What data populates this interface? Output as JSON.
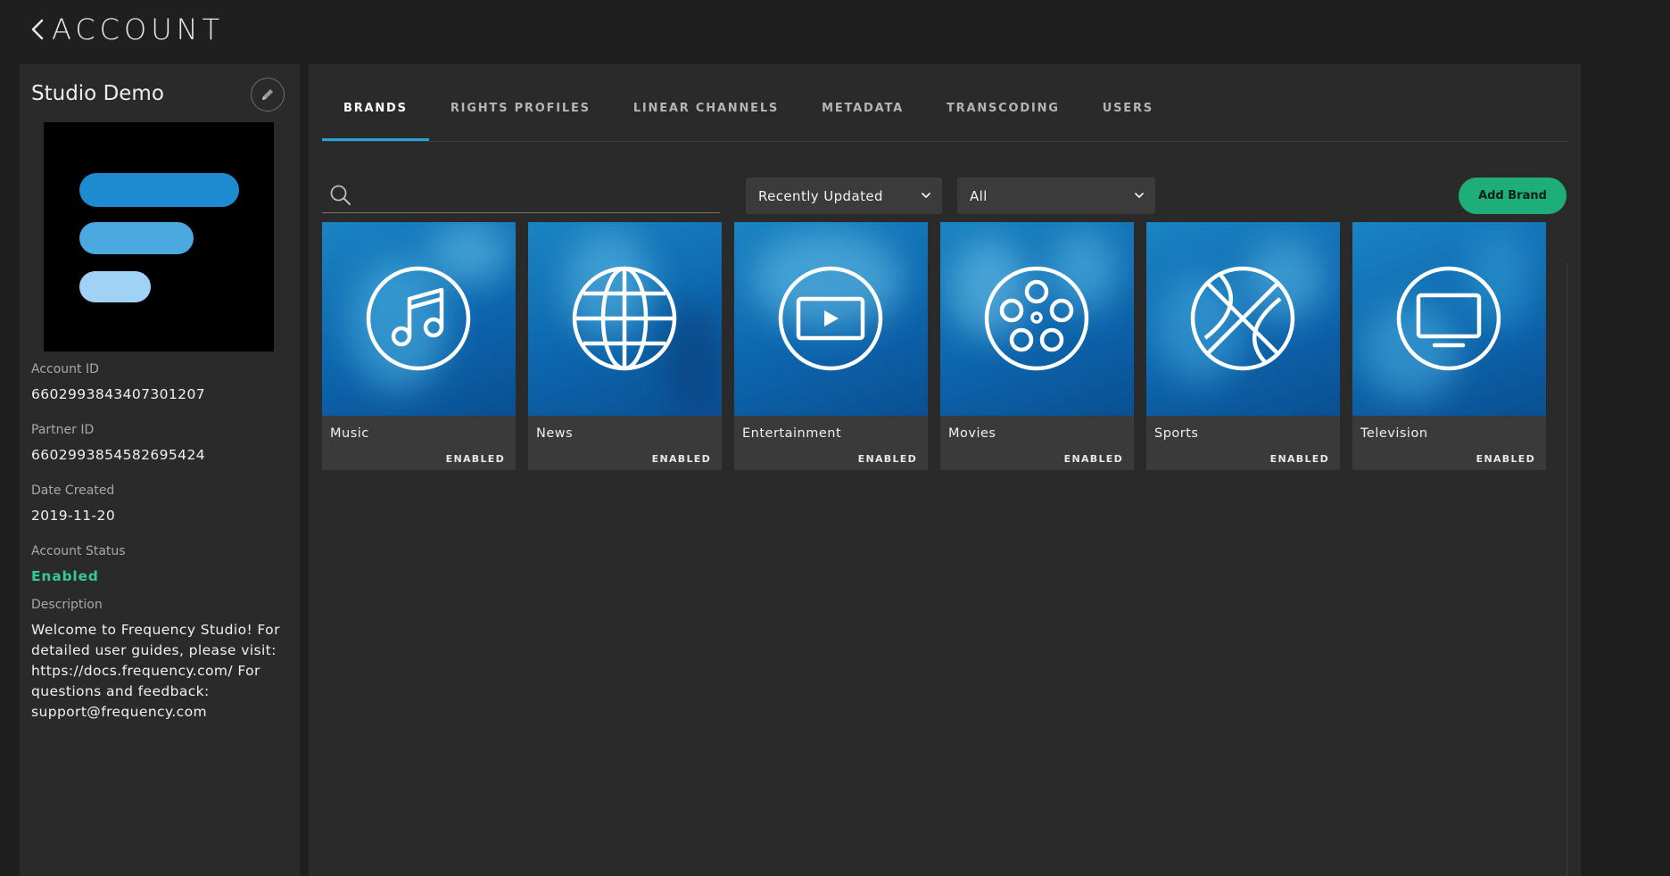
{
  "header": {
    "title": "ACCOUNT",
    "back_icon": "chevron-left-icon"
  },
  "sidebar": {
    "account_name": "Studio Demo",
    "edit_icon": "pencil-icon",
    "logo_colors": [
      "#1e8bd0",
      "#4ba8e0",
      "#9fd2f4"
    ],
    "fields": {
      "account_id": {
        "label": "Account ID",
        "value": "6602993843407301207"
      },
      "partner_id": {
        "label": "Partner ID",
        "value": "6602993854582695424"
      },
      "date_created": {
        "label": "Date Created",
        "value": "2019-11-20"
      },
      "account_status": {
        "label": "Account Status",
        "value": "Enabled",
        "color": "#35c99a"
      },
      "description": {
        "label": "Description",
        "value": "Welcome to Frequency Studio! For detailed user guides, please visit: https://docs.frequency.com/ For questions and feedback: support@frequency.com"
      }
    }
  },
  "tabs": [
    {
      "label": "BRANDS",
      "active": true
    },
    {
      "label": "RIGHTS PROFILES",
      "active": false
    },
    {
      "label": "LINEAR CHANNELS",
      "active": false
    },
    {
      "label": "METADATA",
      "active": false
    },
    {
      "label": "TRANSCODING",
      "active": false
    },
    {
      "label": "USERS",
      "active": false
    }
  ],
  "toolbar": {
    "search_placeholder": "",
    "search_value": "",
    "sort_selected": "Recently Updated",
    "filter_selected": "All",
    "add_button_label": "Add Brand",
    "accent_color": "#1dae79"
  },
  "brands": [
    {
      "name": "Music",
      "status": "ENABLED",
      "icon": "music-note-icon"
    },
    {
      "name": "News",
      "status": "ENABLED",
      "icon": "globe-icon"
    },
    {
      "name": "Entertainment",
      "status": "ENABLED",
      "icon": "play-icon"
    },
    {
      "name": "Movies",
      "status": "ENABLED",
      "icon": "film-reel-icon"
    },
    {
      "name": "Sports",
      "status": "ENABLED",
      "icon": "basketball-icon"
    },
    {
      "name": "Television",
      "status": "ENABLED",
      "icon": "tv-icon"
    }
  ],
  "colors": {
    "tab_active_underline": "#29a3d6",
    "card_blue": "#0d66ad"
  }
}
